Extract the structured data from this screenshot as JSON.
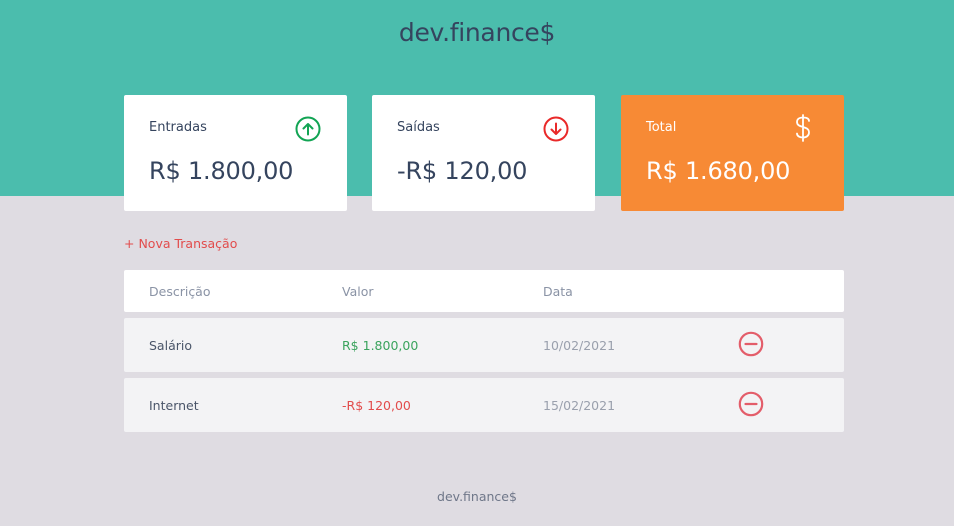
{
  "app": {
    "logo": "dev.finance$"
  },
  "summary": {
    "income": {
      "label": "Entradas",
      "value": "R$ 1.800,00",
      "icon": "arrow-up-circle-icon",
      "icon_color": "#12a454"
    },
    "expense": {
      "label": "Saídas",
      "value": "-R$ 120,00",
      "icon": "arrow-down-circle-icon",
      "icon_color": "#e92929"
    },
    "total": {
      "label": "Total",
      "value": "R$ 1.680,00",
      "icon": "dollar-sign-icon",
      "background": "#f78a35"
    }
  },
  "actions": {
    "new_transaction": "+ Nova Transação"
  },
  "table": {
    "headers": [
      "Descrição",
      "Valor",
      "Data"
    ],
    "rows": [
      {
        "description": "Salário",
        "amount": "R$ 1.800,00",
        "date": "10/02/2021",
        "type": "income"
      },
      {
        "description": "Internet",
        "amount": "-R$ 120,00",
        "date": "15/02/2021",
        "type": "expense"
      }
    ]
  },
  "footer": {
    "text": "dev.finance$"
  },
  "colors": {
    "header": "#4bbdad",
    "background": "#dfdce2",
    "income": "#3aa35d",
    "expense": "#e24c4c",
    "text": "#35445e"
  }
}
